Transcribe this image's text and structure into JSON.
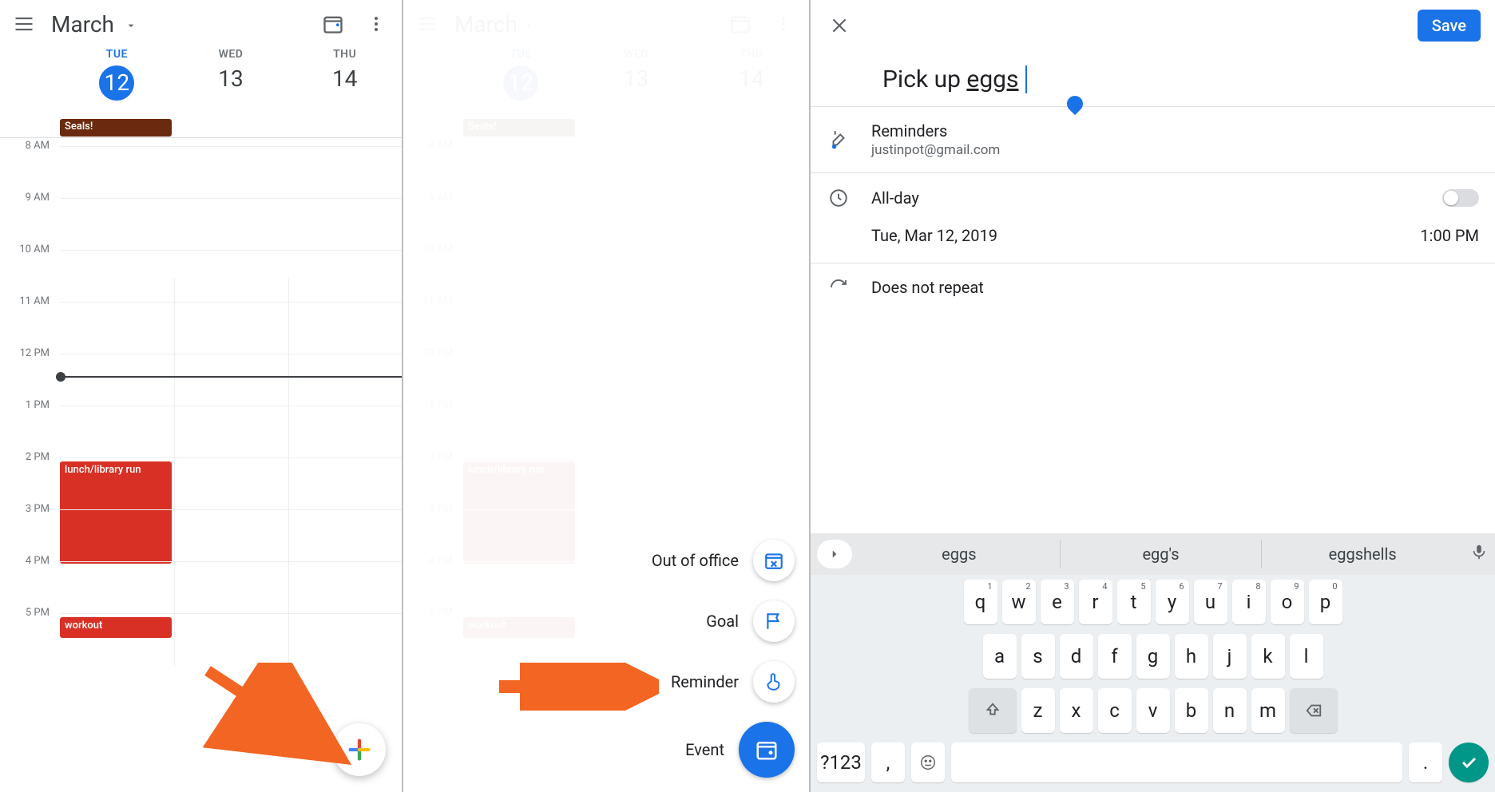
{
  "panel1": {
    "month": "March",
    "days": [
      {
        "dow": "TUE",
        "num": "12",
        "selected": true
      },
      {
        "dow": "WED",
        "num": "13",
        "selected": false
      },
      {
        "dow": "THU",
        "num": "14",
        "selected": false
      }
    ],
    "times": [
      "8 AM",
      "9 AM",
      "10 AM",
      "11 AM",
      "12 PM",
      "1 PM",
      "2 PM",
      "3 PM",
      "4 PM",
      "5 PM"
    ],
    "allday_event": "Seals!",
    "events": {
      "lunch": "lunch/library run",
      "workout": "workout"
    }
  },
  "panel2": {
    "fab_items": [
      {
        "label": "Out of office",
        "icon": "calendar-x"
      },
      {
        "label": "Goal",
        "icon": "flag"
      },
      {
        "label": "Reminder",
        "icon": "finger"
      },
      {
        "label": "Event",
        "icon": "calendar"
      }
    ]
  },
  "panel3": {
    "save": "Save",
    "title_prefix": "Pick up ",
    "title_word": "eggs",
    "calendar_name": "Reminders",
    "calendar_email": "justinpot@gmail.com",
    "allday_label": "All-day",
    "date": "Tue, Mar 12, 2019",
    "time": "1:00 PM",
    "repeat": "Does not repeat",
    "suggestions": [
      "eggs",
      "egg's",
      "eggshells"
    ],
    "keys_row1": [
      "q",
      "w",
      "e",
      "r",
      "t",
      "y",
      "u",
      "i",
      "o",
      "p"
    ],
    "keys_row1_sup": [
      "1",
      "2",
      "3",
      "4",
      "5",
      "6",
      "7",
      "8",
      "9",
      "0"
    ],
    "keys_row2": [
      "a",
      "s",
      "d",
      "f",
      "g",
      "h",
      "j",
      "k",
      "l"
    ],
    "keys_row3": [
      "z",
      "x",
      "c",
      "v",
      "b",
      "n",
      "m"
    ],
    "sym_key": "?123",
    "comma": ",",
    "period": "."
  }
}
